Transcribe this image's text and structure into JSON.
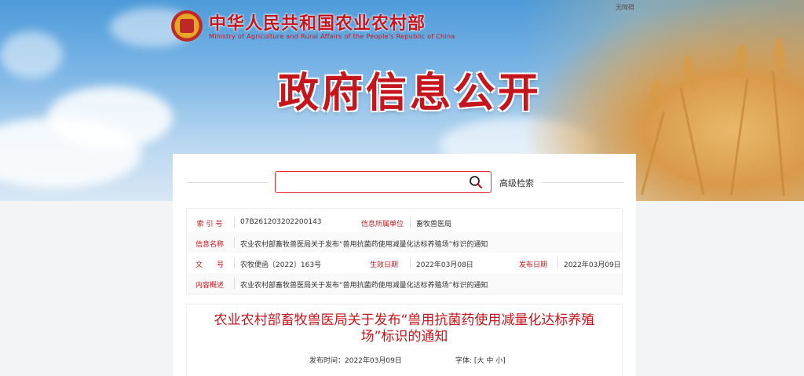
{
  "header": {
    "ministry_cn": "中华人民共和国农业农村部",
    "ministry_en": "Ministry of Agriculture and Rural Affairs of the People's Republic of China",
    "accessibility": "无障碍",
    "page_title": "政府信息公开"
  },
  "search": {
    "placeholder": "",
    "advanced_label": "高级检索"
  },
  "info": {
    "index_label": "索 引 号",
    "index_value": "07B261203202200143",
    "unit_label": "信息所属单位",
    "unit_value": "畜牧兽医局",
    "name_label": "信息名称",
    "name_value": "农业农村部畜牧兽医局关于发布“兽用抗菌药使用减量化达标养殖场”标识的通知",
    "doc_label": "文　　号",
    "doc_value": "农牧便函〔2022〕163号",
    "effective_label": "生效日期",
    "effective_value": "2022年03月08日",
    "publish_label": "发布日期",
    "publish_value": "2022年03月09日",
    "summary_label": "内容概述",
    "summary_value": "农业农村部畜牧兽医局关于发布“兽用抗菌药使用减量化达标养殖场”标识的通知"
  },
  "article": {
    "title": "农业农村部畜牧兽医局关于发布“兽用抗菌药使用减量化达标养殖场”标识的通知",
    "publish_time": "发布时间：2022年03月09日",
    "font_label": "字体:",
    "font_open": "[",
    "font_large": "大",
    "font_medium": "中",
    "font_small": "小",
    "font_close": "]"
  },
  "colors": {
    "accent": "#c4161c",
    "panel_bg": "#ffffff"
  }
}
